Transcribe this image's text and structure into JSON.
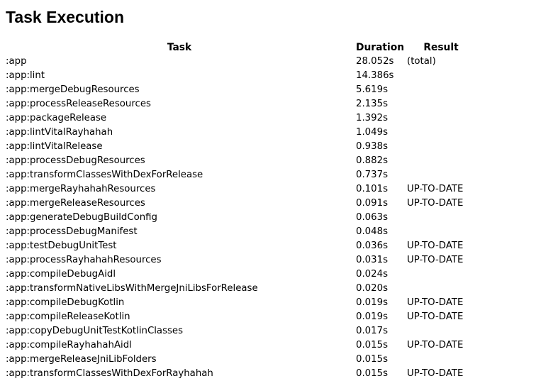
{
  "title": "Task Execution",
  "table": {
    "headers": {
      "task": "Task",
      "duration": "Duration",
      "result": "Result"
    },
    "rows": [
      {
        "task": ":app",
        "duration": "28.052s",
        "result": "(total)"
      },
      {
        "task": ":app:lint",
        "duration": "14.386s",
        "result": ""
      },
      {
        "task": ":app:mergeDebugResources",
        "duration": "5.619s",
        "result": ""
      },
      {
        "task": ":app:processReleaseResources",
        "duration": "2.135s",
        "result": ""
      },
      {
        "task": ":app:packageRelease",
        "duration": "1.392s",
        "result": ""
      },
      {
        "task": ":app:lintVitalRayhahah",
        "duration": "1.049s",
        "result": ""
      },
      {
        "task": ":app:lintVitalRelease",
        "duration": "0.938s",
        "result": ""
      },
      {
        "task": ":app:processDebugResources",
        "duration": "0.882s",
        "result": ""
      },
      {
        "task": ":app:transformClassesWithDexForRelease",
        "duration": "0.737s",
        "result": ""
      },
      {
        "task": ":app:mergeRayhahahResources",
        "duration": "0.101s",
        "result": "UP-TO-DATE"
      },
      {
        "task": ":app:mergeReleaseResources",
        "duration": "0.091s",
        "result": "UP-TO-DATE"
      },
      {
        "task": ":app:generateDebugBuildConfig",
        "duration": "0.063s",
        "result": ""
      },
      {
        "task": ":app:processDebugManifest",
        "duration": "0.048s",
        "result": ""
      },
      {
        "task": ":app:testDebugUnitTest",
        "duration": "0.036s",
        "result": "UP-TO-DATE"
      },
      {
        "task": ":app:processRayhahahResources",
        "duration": "0.031s",
        "result": "UP-TO-DATE"
      },
      {
        "task": ":app:compileDebugAidl",
        "duration": "0.024s",
        "result": ""
      },
      {
        "task": ":app:transformNativeLibsWithMergeJniLibsForRelease",
        "duration": "0.020s",
        "result": ""
      },
      {
        "task": ":app:compileDebugKotlin",
        "duration": "0.019s",
        "result": "UP-TO-DATE"
      },
      {
        "task": ":app:compileReleaseKotlin",
        "duration": "0.019s",
        "result": "UP-TO-DATE"
      },
      {
        "task": ":app:copyDebugUnitTestKotlinClasses",
        "duration": "0.017s",
        "result": ""
      },
      {
        "task": ":app:compileRayhahahAidl",
        "duration": "0.015s",
        "result": "UP-TO-DATE"
      },
      {
        "task": ":app:mergeReleaseJniLibFolders",
        "duration": "0.015s",
        "result": ""
      },
      {
        "task": ":app:transformClassesWithDexForRayhahah",
        "duration": "0.015s",
        "result": "UP-TO-DATE"
      }
    ]
  }
}
